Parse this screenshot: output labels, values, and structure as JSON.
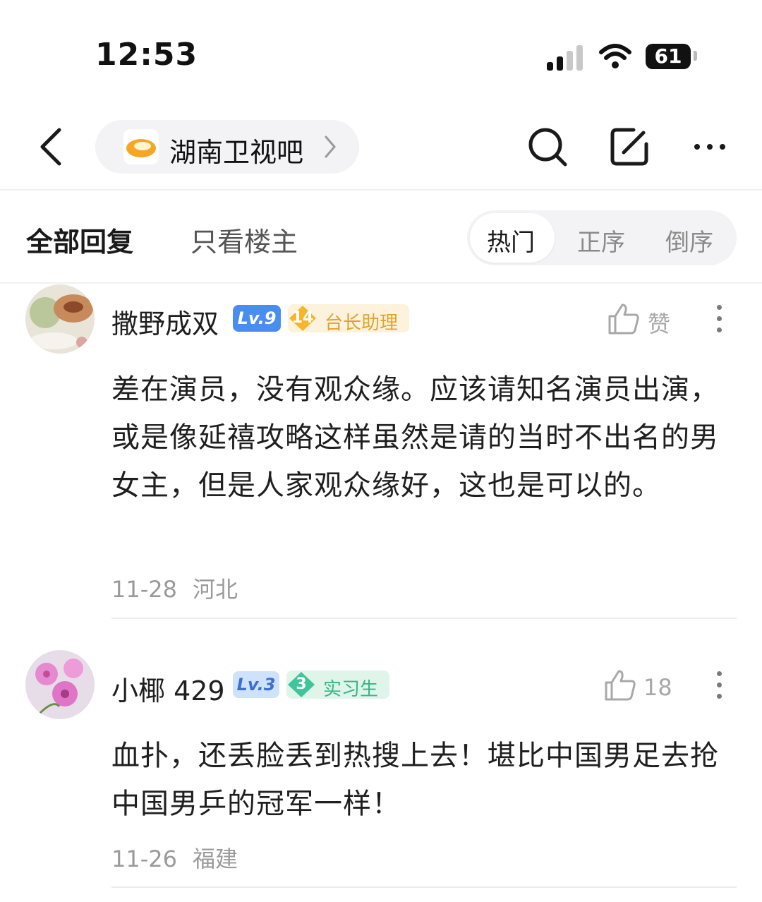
{
  "status_bar": {
    "time": "12:53",
    "battery": "61"
  },
  "header": {
    "forum_name": "湖南卫视吧"
  },
  "tabs": {
    "all": "全部回复",
    "op_only": "只看楼主"
  },
  "sort": {
    "hot": "热门",
    "asc": "正序",
    "desc": "倒序"
  },
  "comments": [
    {
      "username": "撒野成双",
      "level": "Lv.9",
      "badge_num": "14",
      "badge_title": "台长助理",
      "like_label": "赞",
      "content": "差在演员，没有观众缘。应该请知名演员出演，或是像延禧攻略这样虽然是请的当时不出名的男女主，但是人家观众缘好，这也是可以的。",
      "date": "11-28",
      "location": "河北"
    },
    {
      "username": "小椰 429",
      "level": "Lv.3",
      "badge_num": "3",
      "badge_title": "实习生",
      "like_label": "18",
      "content": "血扑，还丢脸丢到热搜上去！堪比中国男足去抢中国男乒的冠军一样！",
      "date": "11-26",
      "location": "福建"
    }
  ],
  "colors": {
    "level_blue": "#4a8df0",
    "badge_gold": "#f5b52e",
    "badge_gold_text": "#e0a233",
    "badge_green": "#3fc59a",
    "badge_green_text": "#36b585"
  },
  "icons": [
    "back-icon",
    "forum-logo-icon",
    "chevron-right-icon",
    "search-icon",
    "edit-icon",
    "more-icon",
    "thumbs-up-icon",
    "vertical-more-icon"
  ]
}
